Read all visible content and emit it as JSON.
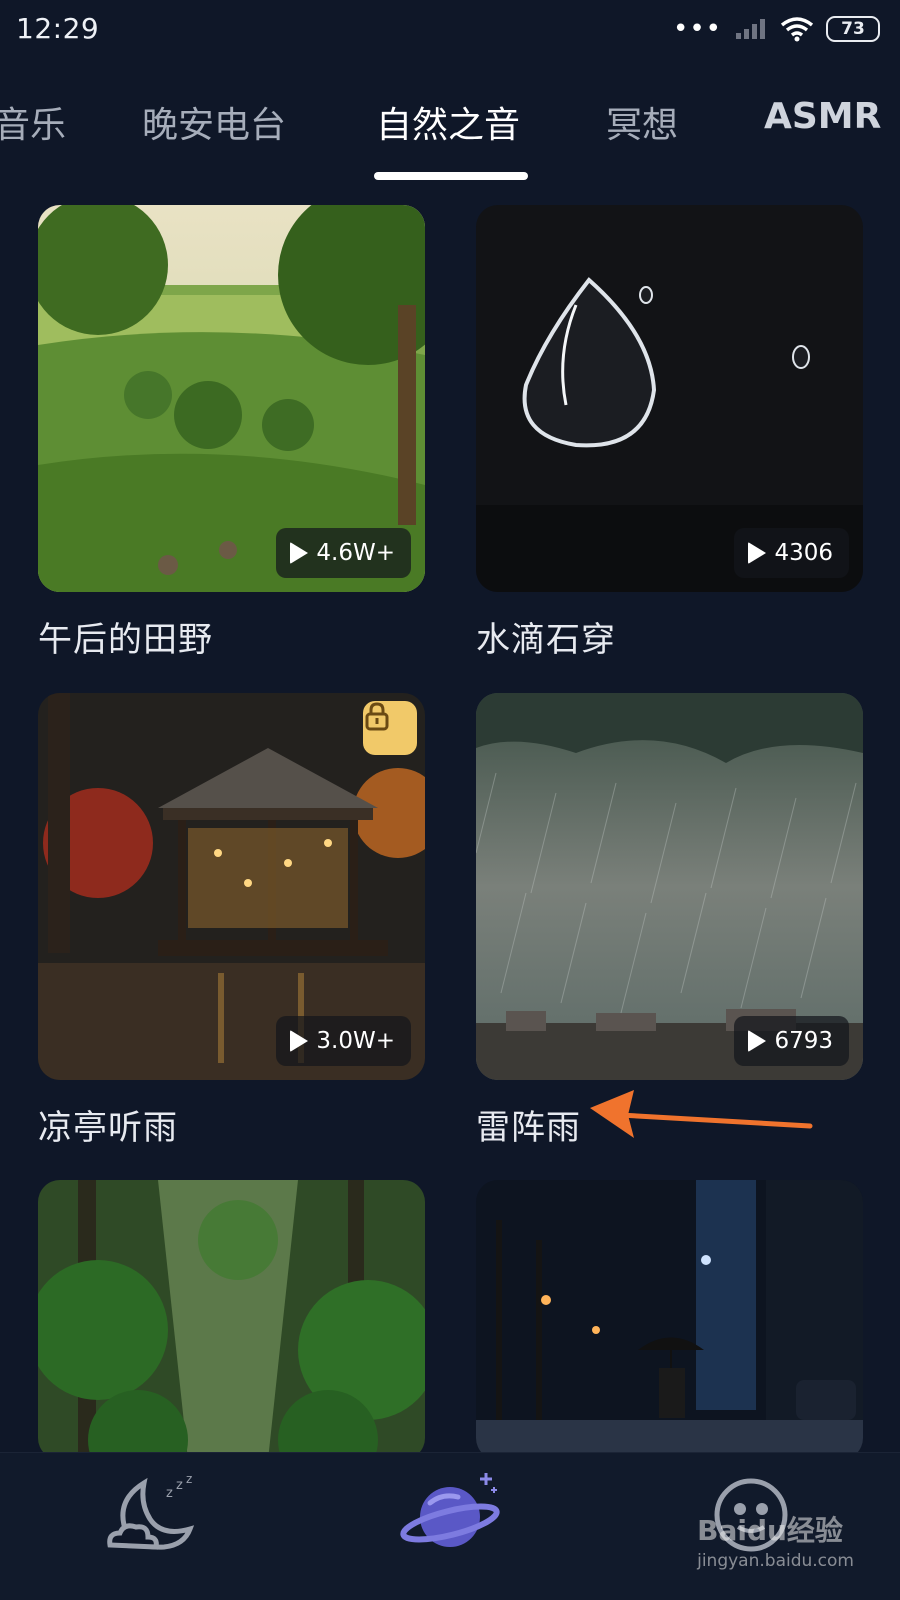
{
  "status_bar": {
    "time": "12:29",
    "battery": "73"
  },
  "tabs": [
    {
      "label": "音乐"
    },
    {
      "label": "晚安电台"
    },
    {
      "label": "自然之音",
      "active": true
    },
    {
      "label": "冥想"
    },
    {
      "label": "ASMR"
    }
  ],
  "cards": [
    {
      "title": "午后的田野",
      "plays": "4.6W+",
      "locked": false
    },
    {
      "title": "水滴石穿",
      "plays": "4306",
      "locked": false
    },
    {
      "title": "凉亭听雨",
      "plays": "3.0W+",
      "locked": true
    },
    {
      "title": "雷阵雨",
      "plays": "6793",
      "locked": false
    },
    {
      "title": "",
      "plays": "",
      "locked": false
    },
    {
      "title": "",
      "plays": "",
      "locked": false
    }
  ],
  "bottom_nav": [
    {
      "icon": "moon-sleep-icon"
    },
    {
      "icon": "planet-icon",
      "active": true
    },
    {
      "icon": "profile-icon"
    }
  ],
  "watermark": {
    "brand": "Baidu经验",
    "url": "jingyan.baidu.com"
  },
  "colors": {
    "background": "#0f1728",
    "accent_lock": "#f1c969",
    "arrow": "#f0732d"
  }
}
